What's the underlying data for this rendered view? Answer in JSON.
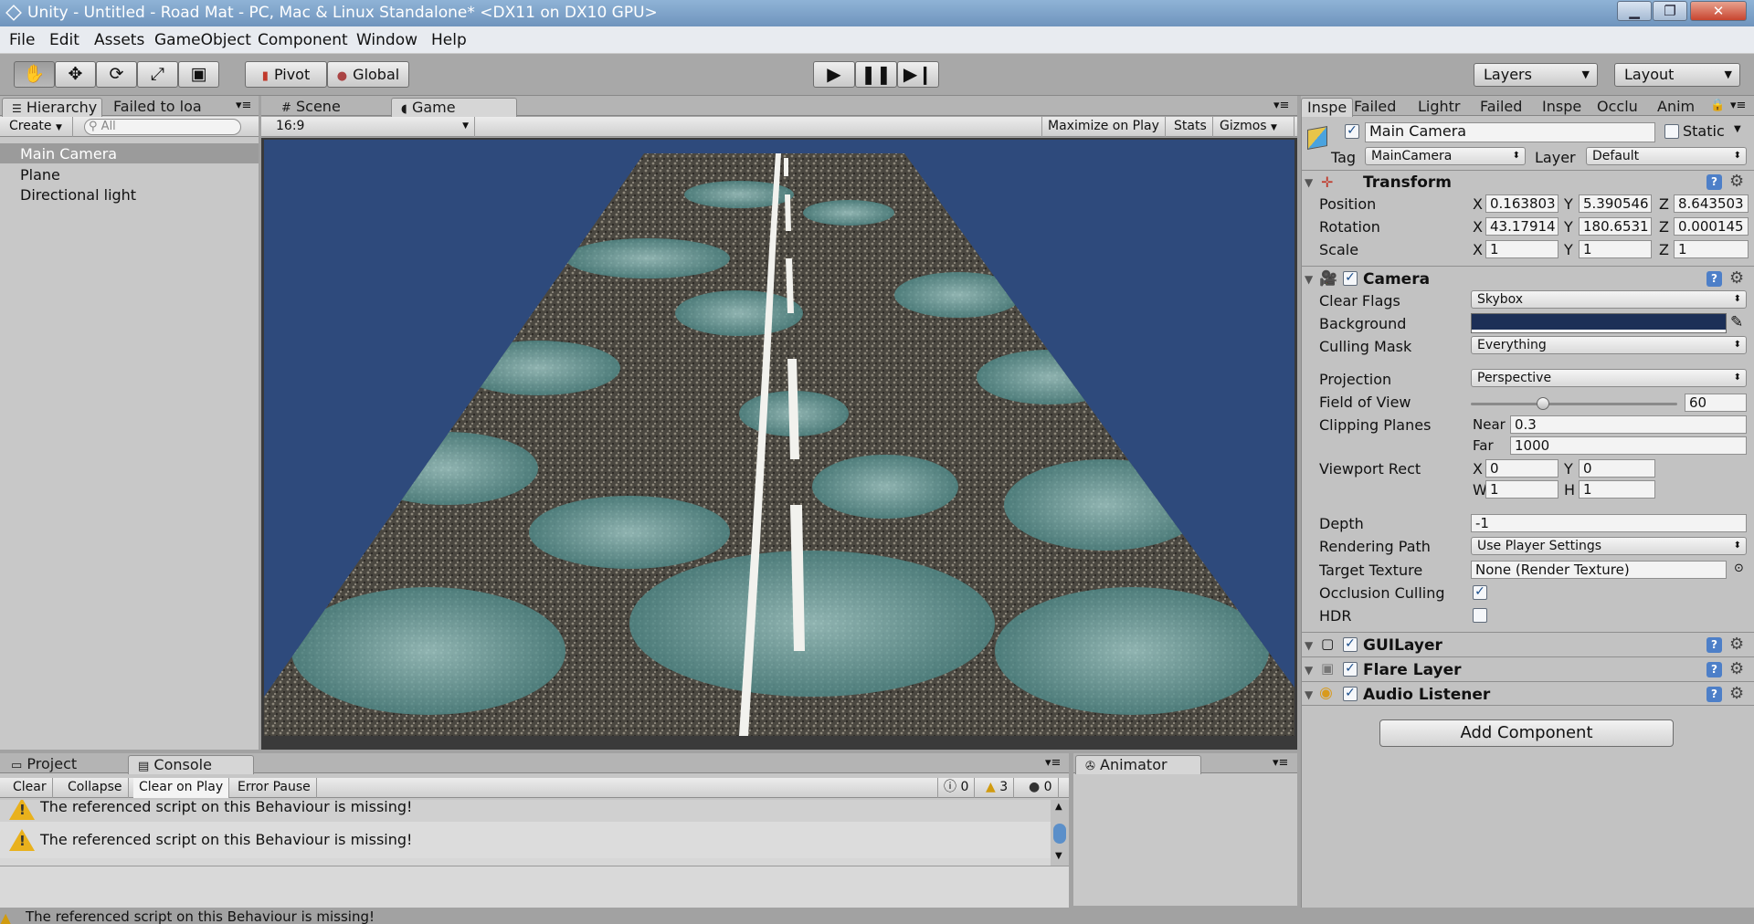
{
  "window": {
    "title": "Unity - Untitled - Road Mat - PC, Mac & Linux Standalone* <DX11 on DX10 GPU>",
    "minimize": "▁",
    "maximize": "❐",
    "close": "✕"
  },
  "menu": [
    "File",
    "Edit",
    "Assets",
    "GameObject",
    "Component",
    "Window",
    "Help"
  ],
  "toolbar": {
    "pivot": "Pivot",
    "global": "Global",
    "layers": "Layers",
    "layout": "Layout"
  },
  "hierarchy": {
    "tabs": [
      "Hierarchy",
      "Failed to loa"
    ],
    "create": "Create",
    "search_placeholder": "All",
    "items": [
      "Main Camera",
      "Plane",
      "Directional light"
    ]
  },
  "center": {
    "tabs": [
      "Scene",
      "Game"
    ],
    "aspect": "16:9",
    "maximize": "Maximize on Play",
    "stats": "Stats",
    "gizmos": "Gizmos"
  },
  "bottom": {
    "tabs": [
      "Project",
      "Console"
    ],
    "buttons": [
      "Clear",
      "Collapse",
      "Clear on Play",
      "Error Pause"
    ],
    "counts": {
      "errors_info": "0",
      "warnings": "3",
      "errors": "0"
    },
    "messages": [
      "The referenced script on this Behaviour is missing!",
      "The referenced script on this Behaviour is missing!"
    ],
    "animator_tab": "Animator",
    "status": "The referenced script on this Behaviour is missing!"
  },
  "inspector": {
    "tabs": [
      "Inspe",
      "Failed",
      "Lightr",
      "Failed",
      "Inspe",
      "Occlu",
      "Anim"
    ],
    "object_name": "Main Camera",
    "static_label": "Static",
    "tag_label": "Tag",
    "tag_value": "MainCamera",
    "layer_label": "Layer",
    "layer_value": "Default",
    "transform": {
      "title": "Transform",
      "position_label": "Position",
      "rotation_label": "Rotation",
      "scale_label": "Scale",
      "position": [
        "0.163803",
        "5.390546",
        "8.643503"
      ],
      "rotation": [
        "43.17914",
        "180.6531",
        "0.000145"
      ],
      "scale": [
        "1",
        "1",
        "1"
      ]
    },
    "camera": {
      "title": "Camera",
      "clear_flags_label": "Clear Flags",
      "clear_flags": "Skybox",
      "background_label": "Background",
      "background_color": "#1c2f57",
      "culling_mask_label": "Culling Mask",
      "culling_mask": "Everything",
      "projection_label": "Projection",
      "projection": "Perspective",
      "fov_label": "Field of View",
      "fov": "60",
      "fov_fraction": 0.35,
      "clipping_label": "Clipping Planes",
      "near_label": "Near",
      "near": "0.3",
      "far_label": "Far",
      "far": "1000",
      "viewport_label": "Viewport Rect",
      "vx": "0",
      "vy": "0",
      "vw": "1",
      "vh": "1",
      "depth_label": "Depth",
      "depth": "-1",
      "rendering_path_label": "Rendering Path",
      "rendering_path": "Use Player Settings",
      "target_texture_label": "Target Texture",
      "target_texture": "None (Render Texture)",
      "occlusion_label": "Occlusion Culling",
      "hdr_label": "HDR"
    },
    "components": [
      "GUILayer",
      "Flare Layer",
      "Audio Listener"
    ],
    "add_component": "Add Component"
  },
  "axis_labels": {
    "x": "X",
    "y": "Y",
    "z": "Z",
    "w": "W",
    "h": "H"
  },
  "colors": {
    "sky": "#2e4a7c",
    "road": "#4a4740",
    "water": "#6fa3a3",
    "warning": "#e9b11c"
  }
}
